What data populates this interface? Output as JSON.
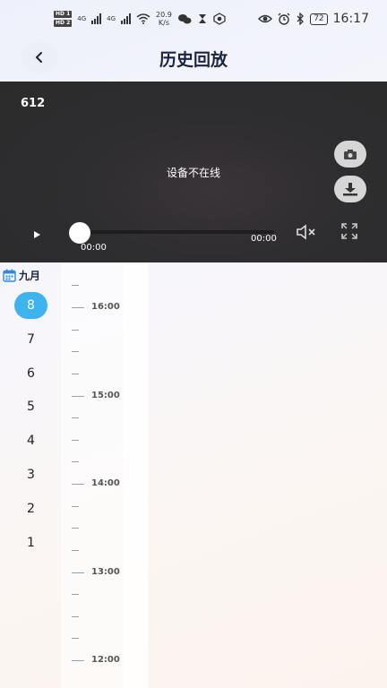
{
  "status_bar": {
    "hd_top": "HD 1",
    "hd_bottom": "HD 2",
    "net_type_1": "4G",
    "net_type_2": "4G",
    "net_speed": "20.9",
    "net_unit": "K/s",
    "battery": "72",
    "time": "16:17"
  },
  "header": {
    "title": "历史回放"
  },
  "player": {
    "channel": "612",
    "status_message": "设备不在线",
    "progress": 0,
    "time_start": "00:00",
    "time_end": "00:00"
  },
  "calendar": {
    "month": "九月",
    "days": [
      "8",
      "7",
      "6",
      "5",
      "4",
      "3",
      "2",
      "1"
    ],
    "selected_day": "8",
    "accent": "#3fb3ee"
  },
  "timeline": {
    "labels": [
      "16:00",
      "15:00",
      "14:00",
      "13:00",
      "12:00"
    ]
  }
}
